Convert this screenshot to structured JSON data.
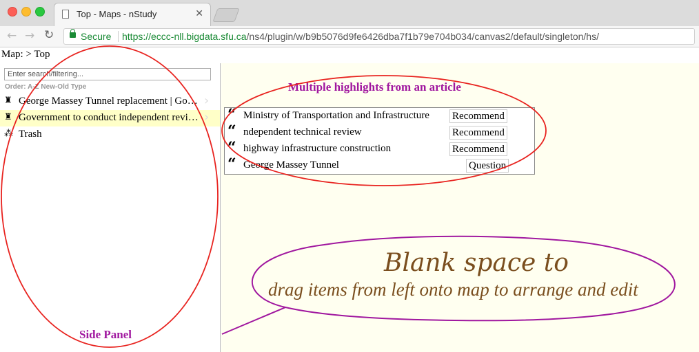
{
  "browser": {
    "tab_title": "Top - Maps - nStudy",
    "close_glyph": "✕",
    "secure_label": "Secure",
    "url_host": "https://eccc-nll.bigdata.sfu.ca",
    "url_path": "/ns4/plugin/w/b9b5076d9fe6426dba7f1b79e704b034/canvas2/default/singleton/hs/"
  },
  "breadcrumb": "Map:  > Top",
  "sidebar": {
    "search_placeholder": "Enter search/filtering...",
    "order_label": "Order: A-Z New-Old Type",
    "items": [
      {
        "label": "George Massey Tunnel replacement | Government to conduct",
        "icon": "pin-star-icon"
      },
      {
        "label": "Government to conduct independent review of George Massey",
        "icon": "pin-star-icon"
      },
      {
        "label": "Trash",
        "icon": "trash-network-icon"
      }
    ]
  },
  "map": {
    "highlights": [
      {
        "text": "Ministry of Transportation and Infrastructure",
        "tag": "Recommend"
      },
      {
        "text": "ndependent technical review",
        "tag": "Recommend"
      },
      {
        "text": "highway infrastructure construction",
        "tag": "Recommend"
      },
      {
        "text": "George Massey Tunnel",
        "tag": "Question"
      }
    ]
  },
  "annotations": {
    "highlights_note": "Multiple highlights from an article",
    "blank_line1": "Blank space to",
    "blank_line2": "drag items from left onto map to arrange and edit",
    "side_panel": "Side Panel"
  },
  "colors": {
    "annotation_red": "#e8231f",
    "annotation_purple": "#a0179f",
    "map_background": "#fffff0",
    "selected_row": "#ffffc8",
    "secure_green": "#1a8a35"
  }
}
